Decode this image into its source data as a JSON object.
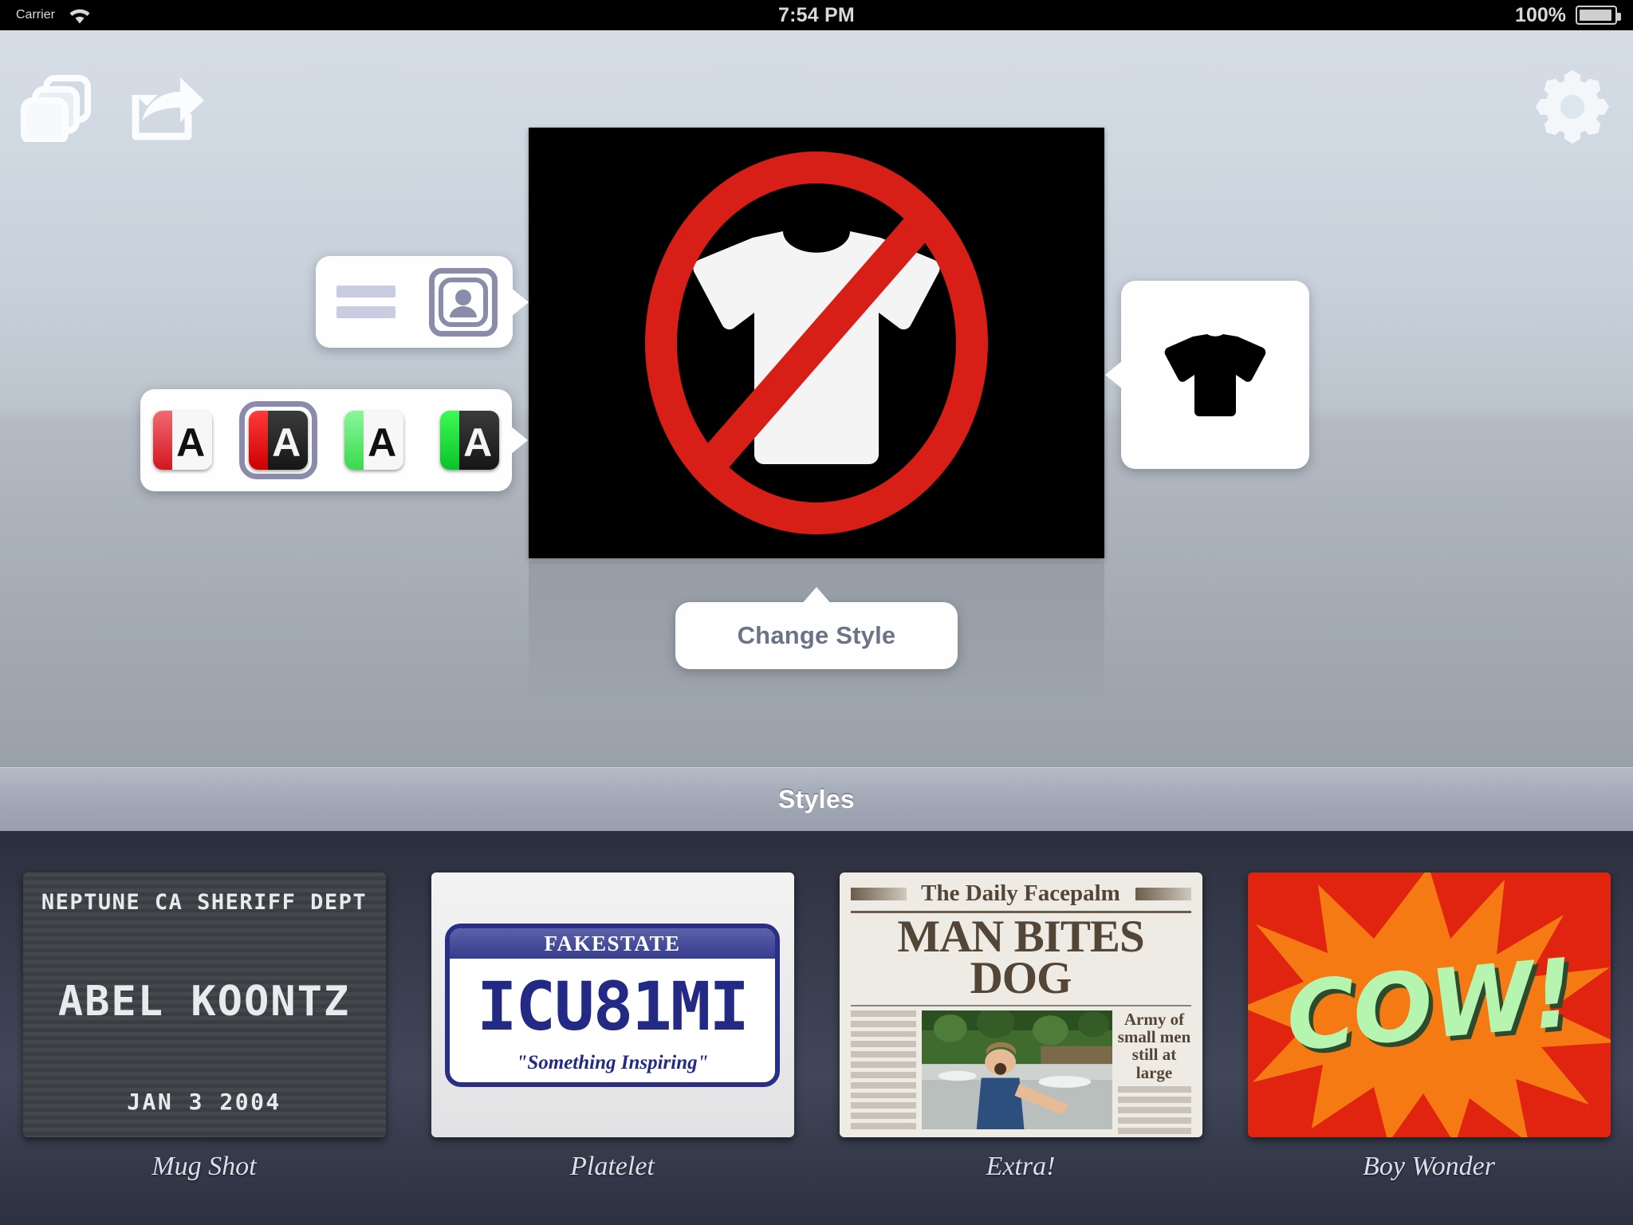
{
  "status_bar": {
    "carrier": "Carrier",
    "wifi_icon": "wifi-icon",
    "time": "7:54 PM",
    "battery_percent": "100%",
    "battery_icon": "battery-full-icon"
  },
  "toolbar": {
    "stack_button": "stack-icon",
    "share_button": "share-icon",
    "settings_button": "gear-icon"
  },
  "preview": {
    "image_alt": "no-tshirt-prohibition-sign",
    "background_color": "#000000",
    "sign_color": "#d81f17",
    "shirt_color": "#f4f4f4"
  },
  "popovers": {
    "mode": {
      "items": [
        {
          "name": "text-lines-icon",
          "selected": false
        },
        {
          "name": "portrait-icon",
          "selected": true
        }
      ]
    },
    "colors": {
      "items": [
        {
          "name": "swatch-red-white",
          "bar": "#e8323c",
          "field": "#f7f7f7",
          "letter": "A",
          "letter_color": "#101010",
          "selected": false
        },
        {
          "name": "swatch-red-black",
          "bar": "#e81111",
          "field": "#232323",
          "letter": "A",
          "letter_color": "#f4f4f4",
          "selected": true
        },
        {
          "name": "swatch-green-white",
          "bar": "#4fe863",
          "field": "#f7f7f7",
          "letter": "A",
          "letter_color": "#101010",
          "selected": false
        },
        {
          "name": "swatch-green-black",
          "bar": "#18e03a",
          "field": "#232323",
          "letter": "A",
          "letter_color": "#f4f4f4",
          "selected": false
        }
      ]
    },
    "shirt": {
      "icon": "tshirt-icon",
      "color": "#000000"
    },
    "change_style": {
      "label": "Change Style",
      "label_color": "#6d7386"
    }
  },
  "styles_section": {
    "header_title": "Styles",
    "items": [
      {
        "caption": "Mug Shot",
        "thumb_type": "mugshot",
        "top_line": "NEPTUNE CA SHERIFF DEPT",
        "name_line": "ABEL KOONTZ",
        "date_line": "JAN 3 2004"
      },
      {
        "caption": "Platelet",
        "thumb_type": "license-plate",
        "state": "FAKESTATE",
        "number": "ICU81MI",
        "slogan": "\"Something Inspiring\"",
        "plate_color": "#232a86"
      },
      {
        "caption": "Extra!",
        "thumb_type": "newspaper",
        "masthead": "The Daily Facepalm",
        "headline_line1": "MAN BITES",
        "headline_line2": "DOG",
        "sidebar_text": "Army of small men still at large",
        "photo_alt": "man-shouting-by-river-photo"
      },
      {
        "caption": "Boy Wonder",
        "thumb_type": "comic-burst",
        "word": "COW!",
        "background_color": "#e02410",
        "burst_color": "#f57a14",
        "word_color": "#b6f5b0"
      }
    ]
  }
}
